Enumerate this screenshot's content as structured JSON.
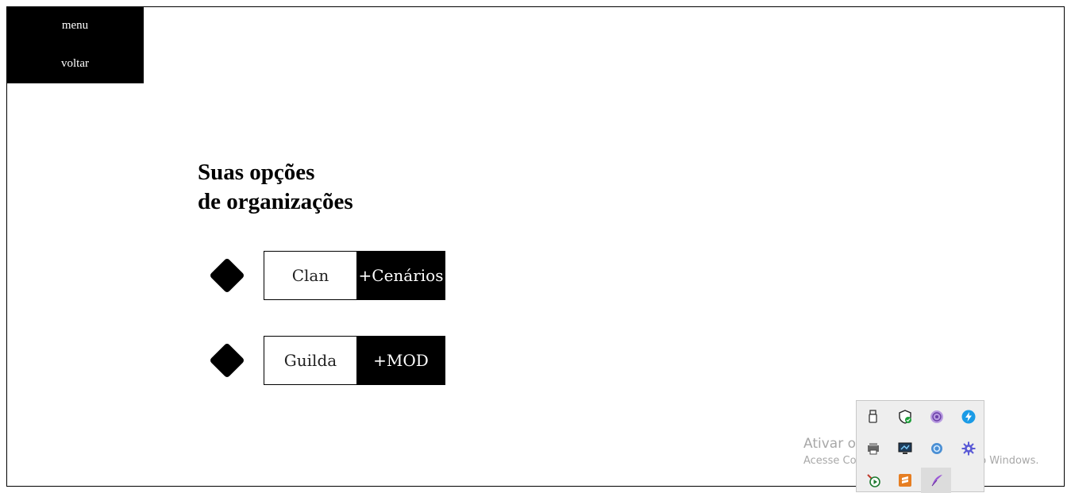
{
  "nav": {
    "menu_label": "menu",
    "back_label": "voltar"
  },
  "heading": {
    "line1": "Suas opções",
    "line2": "de organizações"
  },
  "options": [
    {
      "name": "Clan",
      "action": "+Cenários"
    },
    {
      "name": "Guilda",
      "action": "+MOD"
    }
  ],
  "tray": {
    "icons": [
      "usb-icon",
      "security-shield-icon",
      "tor-icon",
      "lightning-app-icon",
      "printer-icon",
      "display-icon",
      "network-sync-icon",
      "settings-gear-icon",
      "media-play-icon",
      "sublime-text-icon",
      "feather-pen-icon"
    ]
  },
  "watermark": {
    "title": "Ativar o Windows",
    "subtitle": "Acesse Configurações para ativar o Windows."
  }
}
